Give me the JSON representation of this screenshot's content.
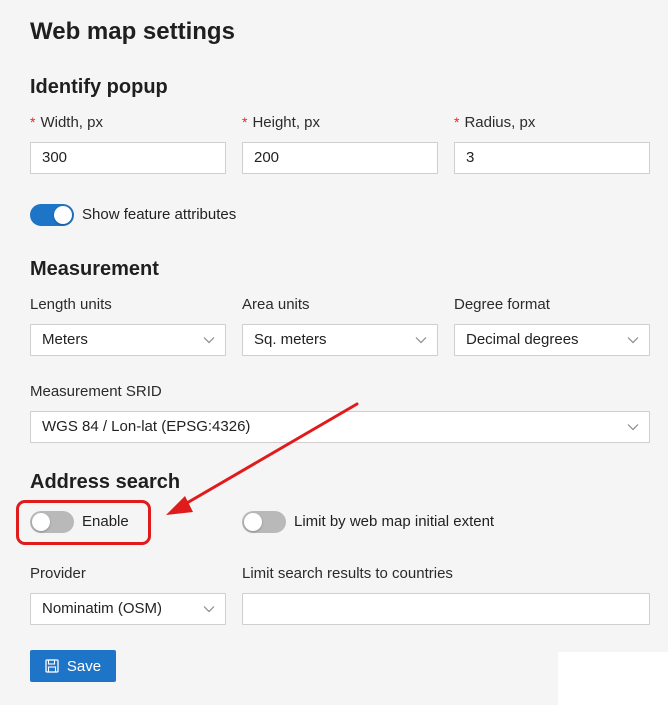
{
  "page": {
    "title": "Web map settings"
  },
  "identify_popup": {
    "title": "Identify popup",
    "width": {
      "label": "Width, px",
      "value": "300",
      "required": true
    },
    "height": {
      "label": "Height, px",
      "value": "200",
      "required": true
    },
    "radius": {
      "label": "Radius, px",
      "value": "3",
      "required": true
    },
    "required_mark": "*",
    "show_feature_attributes": {
      "label": "Show feature attributes",
      "enabled": true
    }
  },
  "measurement": {
    "title": "Measurement",
    "length_units": {
      "label": "Length units",
      "value": "Meters"
    },
    "area_units": {
      "label": "Area units",
      "value": "Sq. meters"
    },
    "degree_format": {
      "label": "Degree format",
      "value": "Decimal degrees"
    },
    "srid": {
      "label": "Measurement SRID",
      "value": "WGS 84 / Lon-lat (EPSG:4326)"
    }
  },
  "address_search": {
    "title": "Address search",
    "enable": {
      "label": "Enable",
      "enabled": false
    },
    "limit_extent": {
      "label": "Limit by web map initial extent",
      "enabled": false
    },
    "provider": {
      "label": "Provider",
      "value": "Nominatim (OSM)"
    },
    "countries": {
      "label": "Limit search results to countries",
      "value": ""
    }
  },
  "actions": {
    "save_label": "Save"
  },
  "colors": {
    "accent": "#1e74c6",
    "annotation": "#e01b1b",
    "required": "#d32f2f"
  },
  "icons": {
    "select_arrow": "chevron-down-icon",
    "save": "floppy-disk-icon"
  }
}
